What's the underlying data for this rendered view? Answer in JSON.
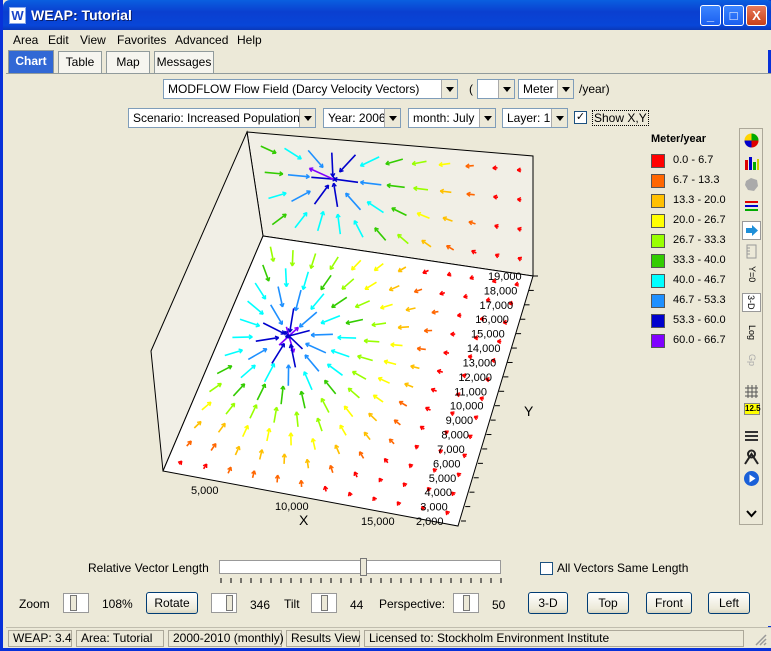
{
  "window": {
    "app_icon_letter": "W",
    "title": "WEAP: Tutorial",
    "controls": [
      "_",
      "□",
      "X"
    ]
  },
  "menu": [
    "Area",
    "Edit",
    "View",
    "Favorites",
    "Advanced",
    "Help"
  ],
  "tabs": [
    "Chart",
    "Table",
    "Map",
    "Messages"
  ],
  "active_tab": "Chart",
  "controls_row1": {
    "variable": "MODFLOW Flow Field (Darcy Velocity Vectors)",
    "open_paren": "(",
    "scale": "",
    "unit": "Meter",
    "unit_suffix": "/year)"
  },
  "controls_row2": {
    "scenario": "Scenario: Increased Population",
    "year": "Year: 2006",
    "month": "month: July",
    "layer": "Layer: 1",
    "show_xy_label": "Show X,Y",
    "show_xy_checked": "✓"
  },
  "legend": {
    "title": "Meter/year",
    "items": [
      {
        "label": "0.0 - 6.7",
        "color": "#ff0000"
      },
      {
        "label": "6.7 - 13.3",
        "color": "#ff6600"
      },
      {
        "label": "13.3 - 20.0",
        "color": "#ffc000"
      },
      {
        "label": "20.0 - 26.7",
        "color": "#ffff00"
      },
      {
        "label": "26.7 - 33.3",
        "color": "#99ff00"
      },
      {
        "label": "33.3 - 40.0",
        "color": "#33cc00"
      },
      {
        "label": "40.0 - 46.7",
        "color": "#00ffff"
      },
      {
        "label": "46.7 - 53.3",
        "color": "#1e90ff"
      },
      {
        "label": "53.3 - 60.0",
        "color": "#0000cc"
      },
      {
        "label": "60.0 - 66.7",
        "color": "#8000ff"
      }
    ]
  },
  "axes": {
    "y_label": "Y",
    "y_ticks": [
      "19,000",
      "18,000",
      "17,000",
      "16,000",
      "15,000",
      "14,000",
      "13,000",
      "12,000",
      "11,000",
      "10,000",
      "9,000",
      "8,000",
      "7,000",
      "6,000",
      "5,000",
      "4,000",
      "3,000",
      "2,000"
    ],
    "x_label": "X",
    "x_ticks": [
      "5,000",
      "10,000",
      "15,000"
    ]
  },
  "right_toolbar": [
    "color-wheel-icon",
    "bar-chart-icon",
    "map-shape-icon",
    "lines-icon",
    "arrow-right-icon",
    "ruler-icon",
    "Y=0",
    "3-D",
    "Log",
    "Gp",
    "grid-icon",
    "12.5",
    "list-icon",
    "font-icon",
    "play-icon"
  ],
  "right_toolbar_text": {
    "y0": "Y=0",
    "threed": "3-D",
    "log": "Log",
    "gp": "Gp",
    "num": "12.5"
  },
  "vector_length": {
    "label": "Relative Vector Length",
    "value": 0.51,
    "all_same_label": "All Vectors Same Length"
  },
  "bottom": {
    "zoom_label": "Zoom",
    "zoom_value": "108%",
    "rotate": "Rotate",
    "rotate_value": "346",
    "tilt_label": "Tilt",
    "tilt_value": "44",
    "perspective_label": "Perspective:",
    "perspective_value": "50",
    "btn_3d": "3-D",
    "btn_top": "Top",
    "btn_front": "Front",
    "btn_left": "Left"
  },
  "status": [
    "WEAP: 3.4",
    "Area: Tutorial",
    "2000-2010 (monthly)",
    "Results View",
    "Licensed to: Stockholm Environment Institute"
  ]
}
